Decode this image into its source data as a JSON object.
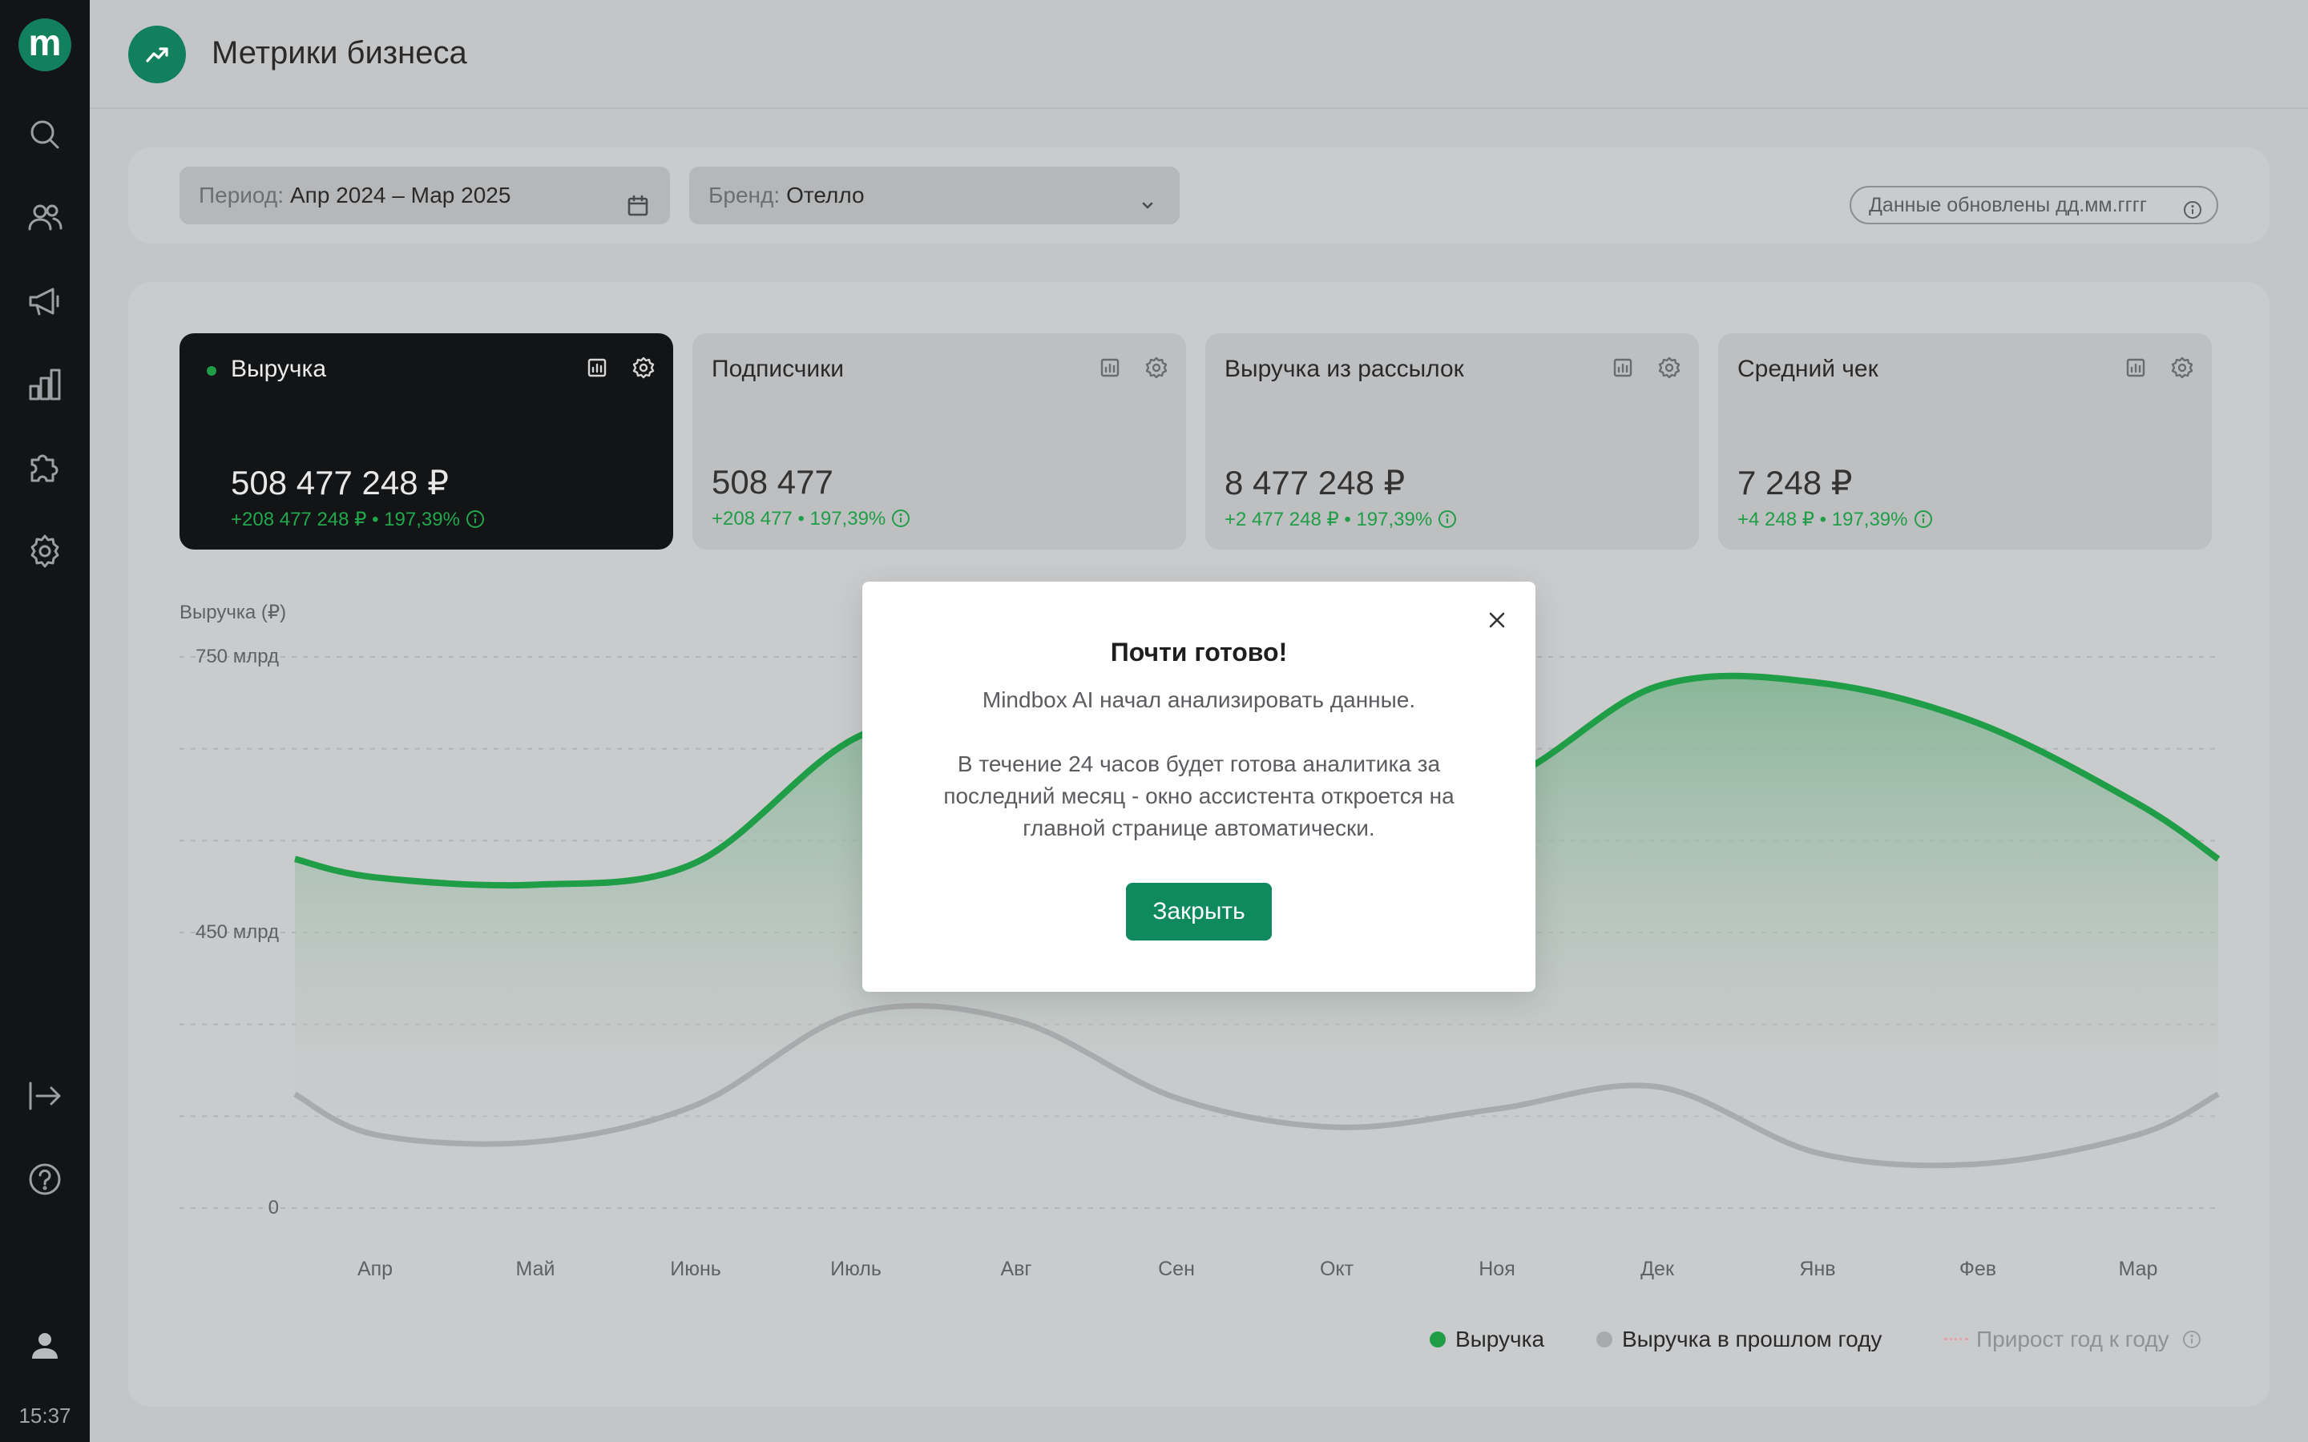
{
  "app": {
    "logo_letter": "m",
    "time": "15:37"
  },
  "sidebar": {
    "items": [
      {
        "icon": "search-icon"
      },
      {
        "icon": "users-icon"
      },
      {
        "icon": "megaphone-icon"
      },
      {
        "icon": "bar-chart-icon"
      },
      {
        "icon": "puzzle-icon"
      },
      {
        "icon": "gear-icon"
      },
      {
        "icon": "logout-icon"
      },
      {
        "icon": "help-icon"
      },
      {
        "icon": "user-icon"
      }
    ]
  },
  "header": {
    "title": "Метрики бизнеса",
    "icon": "trending-up-icon"
  },
  "filters": {
    "period_label": "Период:",
    "period_value": "Апр 2024 – Мар 2025",
    "brand_label": "Бренд:",
    "brand_value": "Отелло",
    "updated": "Данные обновлены дд.мм.гггг"
  },
  "cards": [
    {
      "title": "Выручка",
      "value": "508 477 248 ₽",
      "delta": "+208 477 248 ₽ • 197,39%",
      "active": true
    },
    {
      "title": "Подписчики",
      "value": "508 477",
      "delta": "+208 477 • 197,39%"
    },
    {
      "title": "Выручка из рассылок",
      "value": "8 477 248 ₽",
      "delta": "+2 477 248 ₽ • 197,39%"
    },
    {
      "title": "Средний чек",
      "value": "7 248 ₽",
      "delta": "+4 248 ₽ • 197,39%"
    }
  ],
  "chart_data": {
    "type": "area",
    "ylabel": "Выручка (₽)",
    "yticks": [
      "750 млрд",
      "450 млрд",
      "0"
    ],
    "ylim": [
      0,
      750
    ],
    "categories": [
      "Апр",
      "Май",
      "Июнь",
      "Июль",
      "Авг",
      "Сен",
      "Окт",
      "Ноя",
      "Дек",
      "Янв",
      "Фев",
      "Мар"
    ],
    "series": [
      {
        "name": "Выручка",
        "color": "#1f9e47",
        "values": [
          450,
          440,
          470,
          640,
          690,
          665,
          590,
          580,
          710,
          715,
          660,
          550
        ],
        "start": 475,
        "end": 475
      },
      {
        "name": "Выручка в прошлом году",
        "color": "#a9aaac",
        "values": [
          100,
          90,
          140,
          265,
          255,
          150,
          110,
          135,
          165,
          75,
          60,
          100
        ],
        "start": 155,
        "end": 155
      }
    ],
    "legend": [
      "Выручка",
      "Выручка в прошлом году",
      "Прирост год к году"
    ],
    "legend_position": "bottom-right"
  },
  "modal": {
    "title": "Почти готово!",
    "text1": "Mindbox AI начал анализировать данные.",
    "text2": "В течение 24 часов будет готова аналитика за последний месяц - окно ассистента откроется на главной странице автоматически.",
    "button": "Закрыть"
  }
}
